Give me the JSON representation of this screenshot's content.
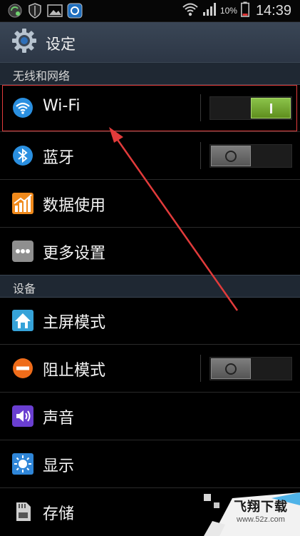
{
  "status_bar": {
    "battery_percent": "10%",
    "clock": "14:39"
  },
  "title_bar": {
    "title": "设定"
  },
  "sections": [
    {
      "header": "无线和网络",
      "items": [
        {
          "label": "Wi-Fi",
          "icon": "wifi-icon",
          "toggle": "on"
        },
        {
          "label": "蓝牙",
          "icon": "bluetooth-icon",
          "toggle": "off"
        },
        {
          "label": "数据使用",
          "icon": "data-usage-icon"
        },
        {
          "label": "更多设置",
          "icon": "more-icon"
        }
      ]
    },
    {
      "header": "设备",
      "items": [
        {
          "label": "主屏模式",
          "icon": "home-screen-icon"
        },
        {
          "label": "阻止模式",
          "icon": "block-icon",
          "toggle": "off"
        },
        {
          "label": "声音",
          "icon": "sound-icon"
        },
        {
          "label": "显示",
          "icon": "display-icon"
        },
        {
          "label": "存储",
          "icon": "storage-icon"
        }
      ]
    }
  ],
  "watermark": {
    "text": "飞翔下载",
    "url": "www.52z.com"
  },
  "colors": {
    "accent_on": "#6fa52a",
    "annotation_red": "#e23b3b",
    "section_bg": "#1f2833"
  }
}
